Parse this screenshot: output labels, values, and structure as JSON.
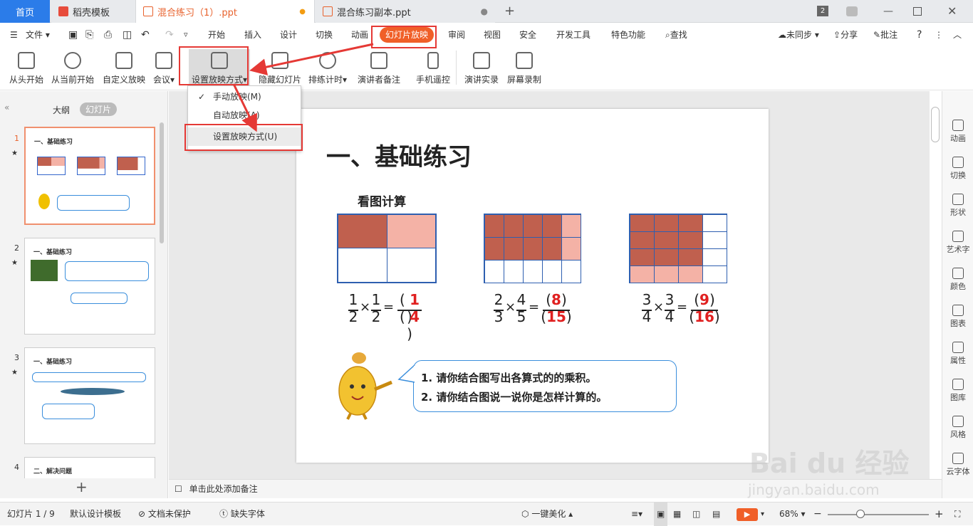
{
  "tabs": {
    "home": "首页",
    "template": "稻壳模板",
    "file1": "混合练习（1）.ppt",
    "file2": "混合练习副本.ppt",
    "new_tab": "+",
    "window_count": "2"
  },
  "menu": {
    "file": "文件",
    "items": [
      "开始",
      "插入",
      "设计",
      "切换",
      "动画",
      "幻灯片放映",
      "审阅",
      "视图",
      "安全",
      "开发工具",
      "特色功能"
    ],
    "search": "查找",
    "unsync": "未同步",
    "share": "分享",
    "comment": "批注",
    "help": "?"
  },
  "ribbon": {
    "buttons": [
      "从头开始",
      "从当前开始",
      "自定义放映",
      "会议",
      "设置放映方式",
      "隐藏幻灯片",
      "排练计时",
      "演讲者备注",
      "手机遥控",
      "演讲实录",
      "屏幕录制"
    ]
  },
  "dropdown": {
    "items": [
      "手动放映(M)",
      "自动放映(A)",
      "设置放映方式(U)"
    ]
  },
  "leftpanel": {
    "outline_tab": "大纲",
    "slides_tab": "幻灯片",
    "numbers": [
      "1",
      "2",
      "3",
      "4"
    ],
    "thumb_titles": [
      "一、基础练习",
      "一、基础练习",
      "一、基础练习",
      "二、解决问题"
    ],
    "add": "+"
  },
  "slide": {
    "title": "一、基础练习",
    "subtitle": "看图计算",
    "eq1": {
      "a": "1",
      "b": "2",
      "c": "1",
      "d": "2",
      "n": "1",
      "m": "4"
    },
    "eq2": {
      "a": "2",
      "b": "3",
      "c": "4",
      "d": "5",
      "n": "8",
      "m": "15"
    },
    "eq3": {
      "a": "3",
      "b": "4",
      "c": "3",
      "d": "4",
      "n": "9",
      "m": "16"
    },
    "ops": {
      "times": "×",
      "eq": "=",
      "lp": "(",
      "rp": ")"
    },
    "bubble1": "1. 请你结合图写出各算式的的乘积。",
    "bubble2": "2. 请你结合图说一说你是怎样计算的。"
  },
  "rightbar": [
    "动画",
    "切换",
    "形状",
    "艺术字",
    "颜色",
    "图表",
    "属性",
    "图库",
    "风格",
    "云字体"
  ],
  "notes": "单击此处添加备注",
  "status": {
    "slide": "幻灯片 1 / 9",
    "design": "默认设计模板",
    "protect": "文档未保护",
    "font": "缺失字体",
    "beautify": "一键美化",
    "zoom": "68%",
    "minus": "−",
    "plus": "+"
  },
  "watermark": {
    "logo": "Bai du 经验",
    "url": "jingyan.baidu.com"
  },
  "colors": {
    "accent": "#f05f28",
    "brown": "#c0604e",
    "pink": "#f4b2a6",
    "gridline": "#2e5fb0",
    "answer": "#e02020"
  }
}
